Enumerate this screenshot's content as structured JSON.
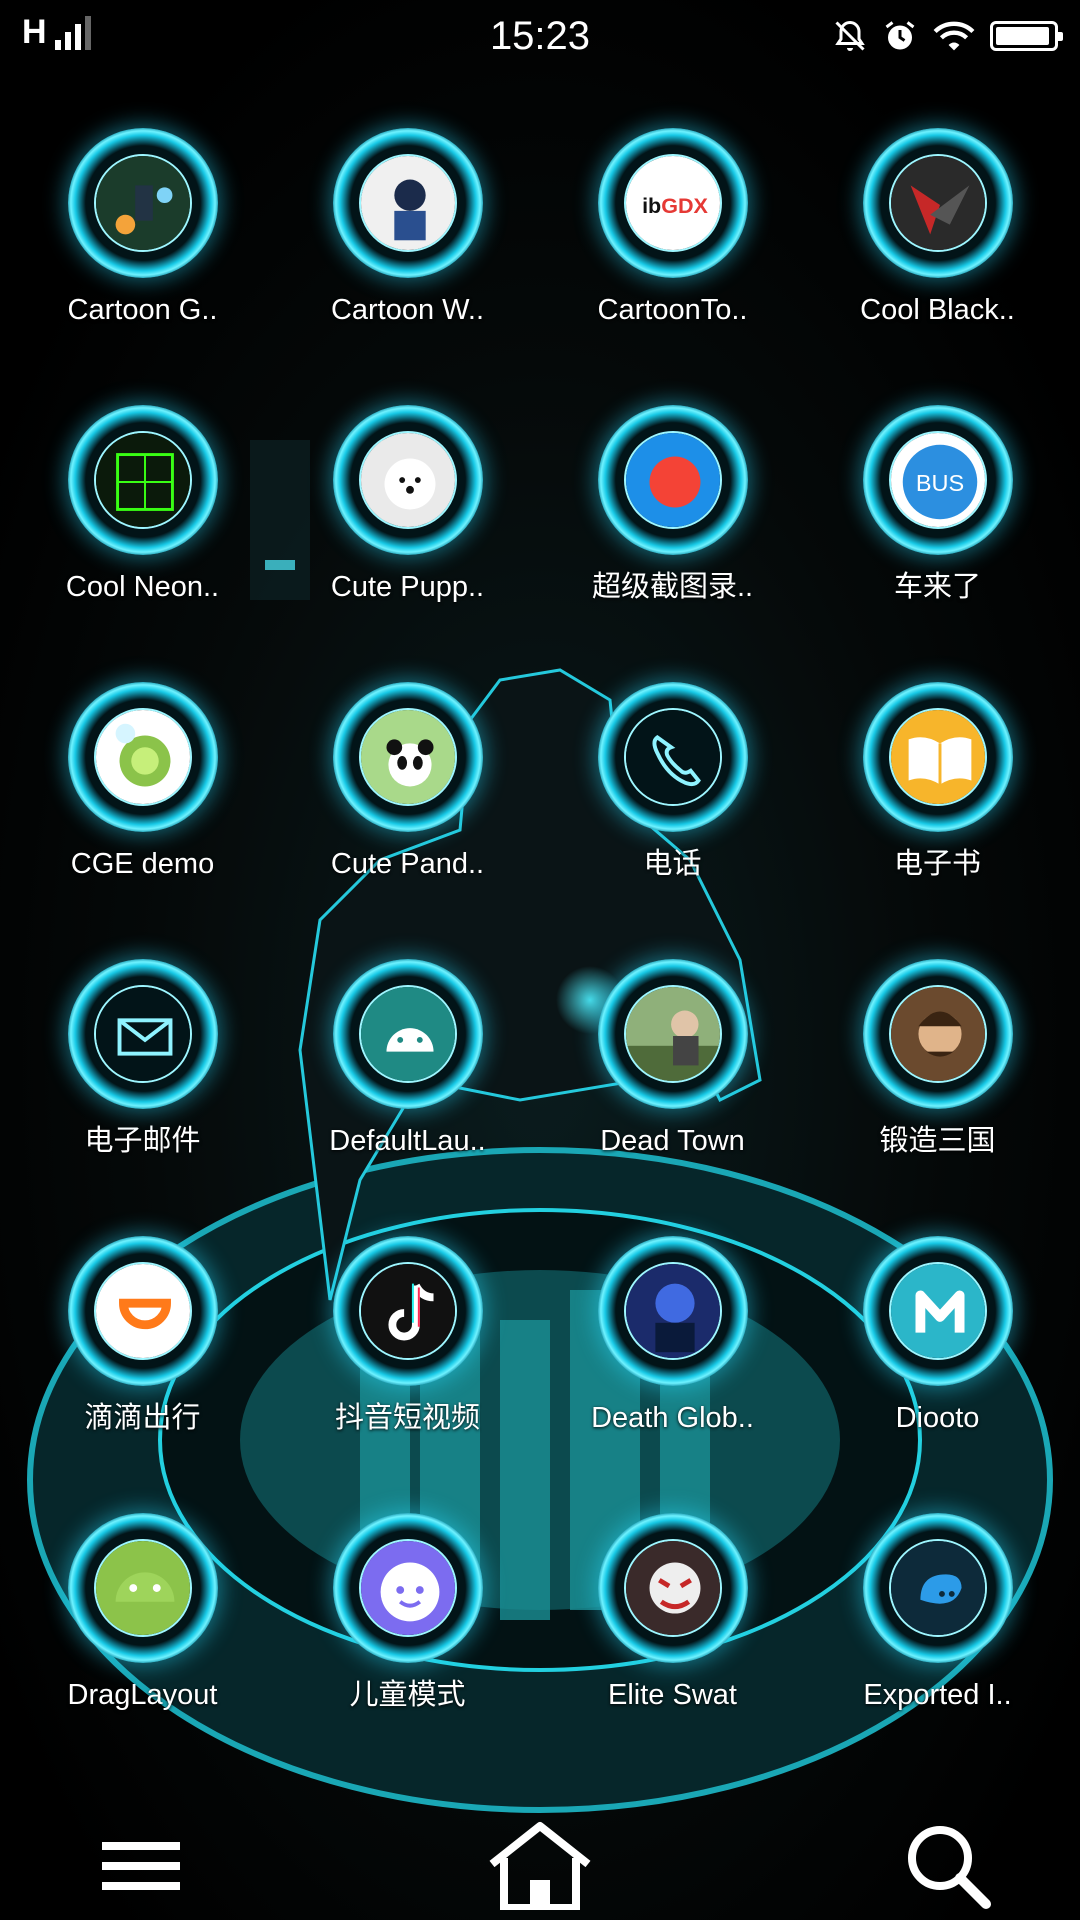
{
  "status_bar": {
    "network": "H",
    "time": "15:23",
    "icons": [
      "signal-icon",
      "notifications-muted-icon",
      "alarm-icon",
      "wifi-icon",
      "battery-icon"
    ],
    "battery_level": 0.95
  },
  "apps": [
    {
      "label": "Cartoon G..",
      "icon": "cartoon-galaxy-theme-icon",
      "color": "#1b3c2b"
    },
    {
      "label": "Cartoon W..",
      "icon": "cartoon-warrior-theme-icon",
      "color": "#f0f0f0"
    },
    {
      "label": "CartoonTo..",
      "icon": "libgdx-icon",
      "color": "#ffffff"
    },
    {
      "label": "Cool Black..",
      "icon": "cool-black-theme-icon",
      "color": "#2a2a2a"
    },
    {
      "label": "Cool Neon..",
      "icon": "cool-neon-theme-icon",
      "color": "#0b1a0b"
    },
    {
      "label": "Cute Pupp..",
      "icon": "cute-puppy-theme-icon",
      "color": "#eaeaea"
    },
    {
      "label": "超级截图录..",
      "icon": "screen-recorder-icon",
      "color": "#1d8fe8"
    },
    {
      "label": "车来了",
      "icon": "bus-icon",
      "color": "#ffffff"
    },
    {
      "label": "CGE demo",
      "icon": "camera-lens-icon",
      "color": "#ffffff"
    },
    {
      "label": "Cute Pand..",
      "icon": "cute-panda-theme-icon",
      "color": "#a9d98a"
    },
    {
      "label": "电话",
      "icon": "phone-icon",
      "color": "#021418"
    },
    {
      "label": "电子书",
      "icon": "ebook-icon",
      "color": "#f7b52b"
    },
    {
      "label": "电子邮件",
      "icon": "email-icon",
      "color": "#021418"
    },
    {
      "label": "DefaultLau..",
      "icon": "android-icon",
      "color": "#1f8a84"
    },
    {
      "label": "Dead Town",
      "icon": "dead-town-game-icon",
      "color": "#8fb07a"
    },
    {
      "label": "锻造三国",
      "icon": "three-kingdoms-game-icon",
      "color": "#6b4a2e"
    },
    {
      "label": "滴滴出行",
      "icon": "didi-icon",
      "color": "#ffffff"
    },
    {
      "label": "抖音短视频",
      "icon": "tiktok-icon",
      "color": "#111111"
    },
    {
      "label": "Death Glob..",
      "icon": "death-globe-theme-icon",
      "color": "#1b2b6b"
    },
    {
      "label": "Diooto",
      "icon": "diooto-icon",
      "color": "#2bb6c9"
    },
    {
      "label": "DragLayout",
      "icon": "android-green-icon",
      "color": "#8cc34a"
    },
    {
      "label": "儿童模式",
      "icon": "kids-mode-icon",
      "color": "#7c6cf0"
    },
    {
      "label": "Elite Swat",
      "icon": "elite-swat-game-icon",
      "color": "#3a2a2a"
    },
    {
      "label": "Exported I..",
      "icon": "exported-bird-icon",
      "color": "#0d2a3a"
    }
  ],
  "dock": {
    "items": [
      "menu-icon",
      "home-icon",
      "search-icon"
    ]
  }
}
